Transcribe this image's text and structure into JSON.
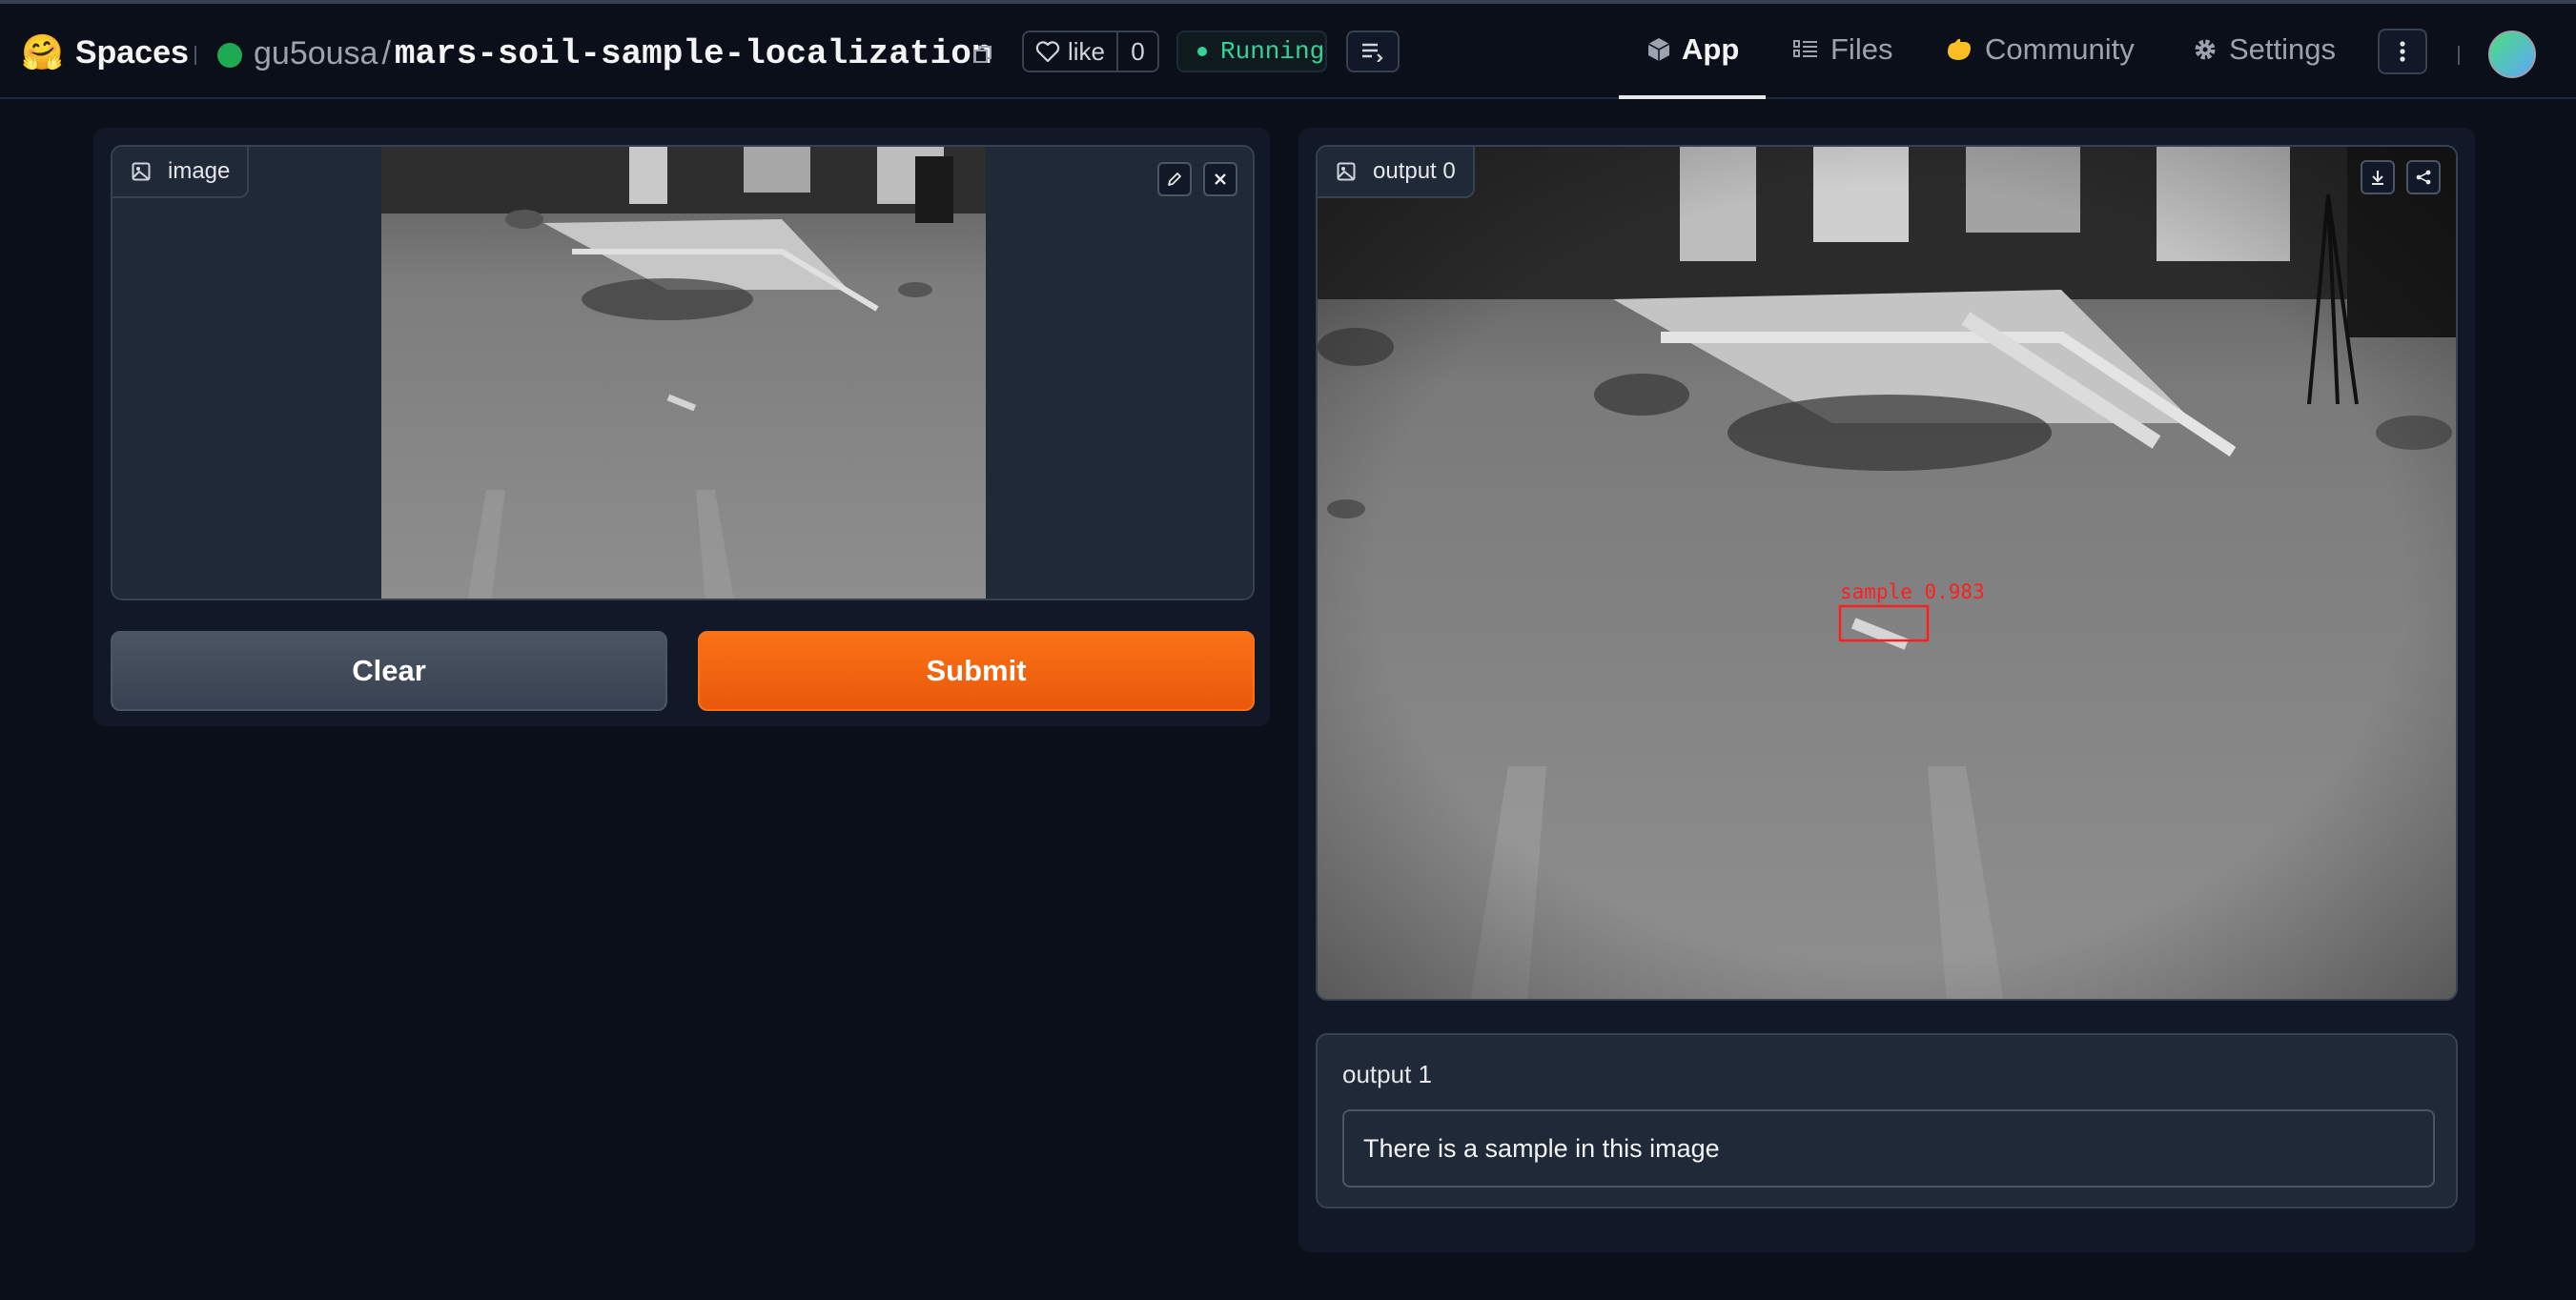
{
  "header": {
    "logo_emoji": "🤗",
    "logo_text": "Spaces",
    "owner": "gu5ousa",
    "slash": "/",
    "repo_name": "mars-soil-sample-localization",
    "like_label": "like",
    "like_count": "0",
    "status": "Running",
    "status_color": "#34d399",
    "tabs": [
      {
        "label": "App",
        "icon": "cube-icon",
        "active": true
      },
      {
        "label": "Files",
        "icon": "files-icon",
        "active": false
      },
      {
        "label": "Community",
        "icon": "community-icon",
        "active": false
      },
      {
        "label": "Settings",
        "icon": "gear-icon",
        "active": false
      }
    ]
  },
  "input_panel": {
    "image_label": "image",
    "clear_label": "Clear",
    "submit_label": "Submit"
  },
  "output_panel": {
    "image_label": "output 0",
    "detection_label": "sample 0.983",
    "text_label": "output 1",
    "text_value": "There is a sample in this image"
  },
  "colors": {
    "background": "#0b0f19",
    "panel": "#111827",
    "submit": "#f97316",
    "detection_box": "#ff1e1e"
  }
}
